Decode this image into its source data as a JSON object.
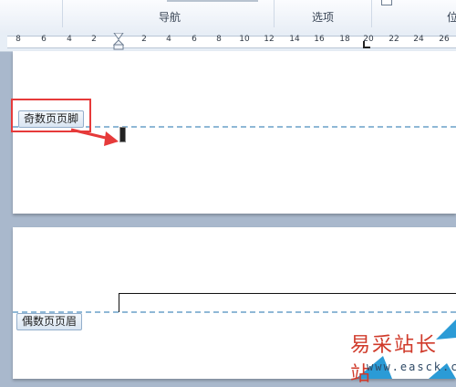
{
  "ribbon": {
    "groups": [
      {
        "label": "导航"
      },
      {
        "label": "选项"
      },
      {
        "label": "位"
      }
    ]
  },
  "ruler": {
    "ticks": [
      "8",
      "6",
      "4",
      "2",
      "2",
      "4",
      "6",
      "8",
      "10",
      "12",
      "14",
      "16",
      "18",
      "20",
      "22",
      "24",
      "26"
    ]
  },
  "page1": {
    "footer_tag": "奇数页页脚"
  },
  "page2": {
    "header_tag": "偶数页页眉"
  },
  "watermark": {
    "chinese": "易采站长站",
    "url": "www.easck.com"
  },
  "colors": {
    "highlight": "#e63a3a",
    "dash": "#8fb8d6",
    "ribbon_bg": "#e8eef6"
  }
}
